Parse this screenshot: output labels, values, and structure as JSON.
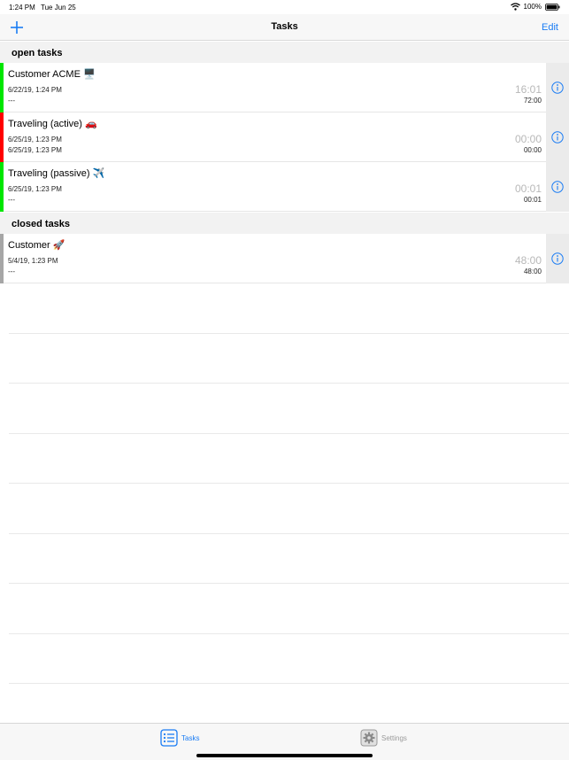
{
  "status_bar": {
    "time": "1:24 PM",
    "date": "Tue Jun 25",
    "battery": "100%"
  },
  "nav": {
    "title": "Tasks",
    "edit_label": "Edit",
    "add_icon": "plus-icon"
  },
  "colors": {
    "accent": "#1a7cf4",
    "active_green": "#00e600",
    "active_red": "#ff0000",
    "closed_gray": "#a6a6a6"
  },
  "sections": {
    "open": {
      "header": "open tasks",
      "tasks": [
        {
          "name": "Customer ACME",
          "emoji": "🖥️",
          "line1": "6/22/19, 1:24 PM",
          "line2": "---",
          "big_time": "16:01",
          "total": "72:00",
          "status": "green"
        },
        {
          "name": "Traveling (active)",
          "emoji": "🚗",
          "line1": "6/25/19, 1:23 PM",
          "line2": "6/25/19, 1:23 PM",
          "big_time": "00:00",
          "total": "00:00",
          "status": "red"
        },
        {
          "name": "Traveling (passive)",
          "emoji": "✈️",
          "line1": "6/25/19, 1:23 PM",
          "line2": "---",
          "big_time": "00:01",
          "total": "00:01",
          "status": "green"
        }
      ]
    },
    "closed": {
      "header": "closed tasks",
      "tasks": [
        {
          "name": "Customer",
          "emoji": "🚀",
          "line1": "5/4/19, 1:23 PM",
          "line2": "---",
          "big_time": "48:00",
          "total": "48:00",
          "status": "gray"
        }
      ]
    }
  },
  "tabs": [
    {
      "label": "Tasks",
      "icon": "list-icon",
      "selected": true
    },
    {
      "label": "Settings",
      "icon": "gear-icon",
      "selected": false
    }
  ]
}
